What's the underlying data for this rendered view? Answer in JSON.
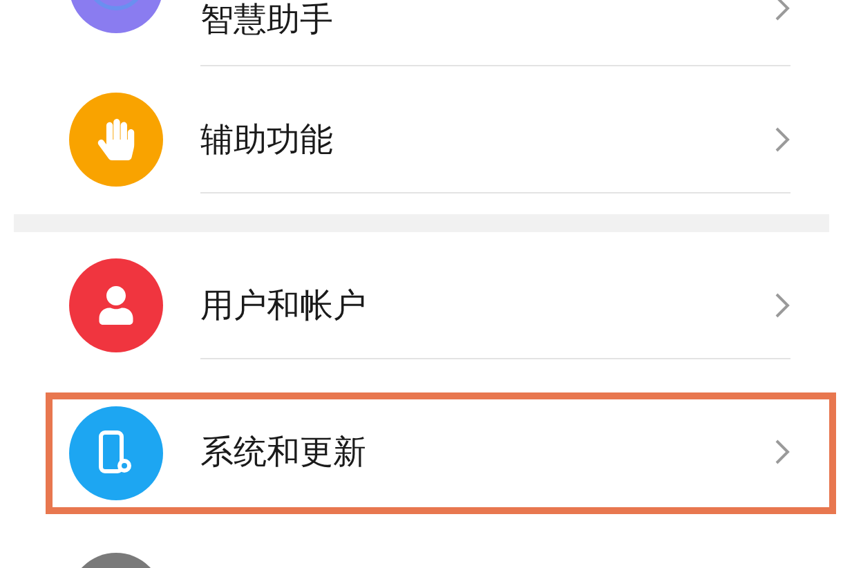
{
  "groups": [
    {
      "items": [
        {
          "kind": "assistant",
          "color": "#8a7cf0",
          "label": "智慧助手",
          "highlighted": false
        },
        {
          "kind": "accessibility",
          "color": "#f9a300",
          "label": "辅助功能",
          "highlighted": false
        }
      ]
    },
    {
      "items": [
        {
          "kind": "user",
          "color": "#f0353f",
          "label": "用户和帐户",
          "highlighted": false
        },
        {
          "kind": "system",
          "color": "#1da6f2",
          "label": "系统和更新",
          "highlighted": true
        },
        {
          "kind": "other",
          "color": "#7a7a7a"
        }
      ]
    }
  ]
}
